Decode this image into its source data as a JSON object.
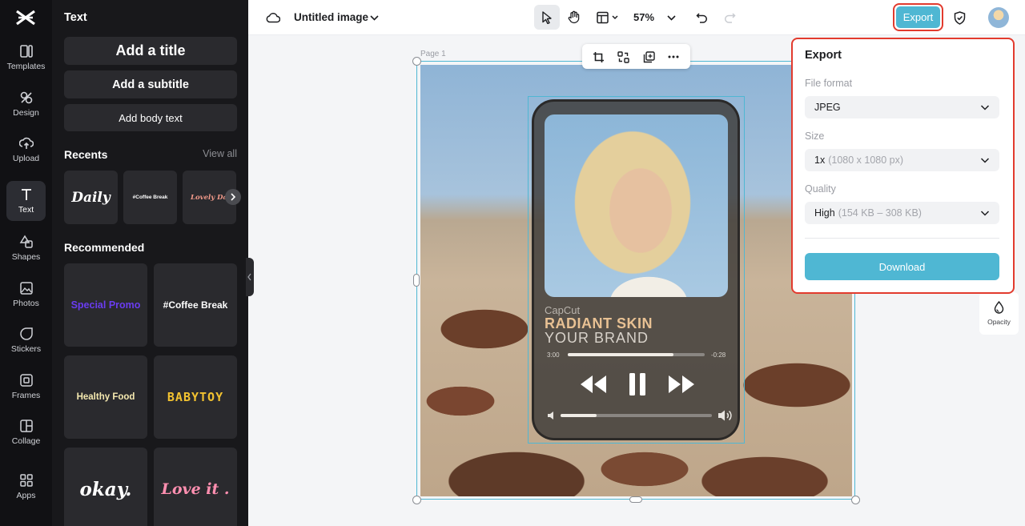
{
  "rail": {
    "items": [
      {
        "label": "Templates",
        "icon": "templates-icon"
      },
      {
        "label": "Design",
        "icon": "design-icon"
      },
      {
        "label": "Upload",
        "icon": "upload-icon"
      },
      {
        "label": "Text",
        "icon": "text-icon"
      },
      {
        "label": "Shapes",
        "icon": "shapes-icon"
      },
      {
        "label": "Photos",
        "icon": "photos-icon"
      },
      {
        "label": "Stickers",
        "icon": "stickers-icon"
      },
      {
        "label": "Frames",
        "icon": "frames-icon"
      },
      {
        "label": "Collage",
        "icon": "collage-icon"
      },
      {
        "label": "Apps",
        "icon": "apps-icon"
      }
    ],
    "active": "Text"
  },
  "panel": {
    "title": "Text",
    "add_title": "Add a title",
    "add_subtitle": "Add a subtitle",
    "add_body": "Add body text",
    "recents_title": "Recents",
    "view_all": "View all",
    "recents": [
      "Daily",
      "#Coffee Break",
      "Lovely Day"
    ],
    "recommended_title": "Recommended",
    "recommended": [
      "Special Promo",
      "#Coffee Break",
      "Healthy Food",
      "BABYTOY",
      "okay.",
      "Love it ."
    ]
  },
  "topbar": {
    "doc_title": "Untitled image",
    "zoom": "57%",
    "export_label": "Export"
  },
  "canvas": {
    "page_label": "Page 1",
    "player": {
      "app_name": "CapCut",
      "headline": "RADIANT SKIN",
      "subline": "YOUR BRAND",
      "time_elapsed": "3:00",
      "time_remaining": "-0:28",
      "progress": 0.77,
      "volume": 0.24
    }
  },
  "side": {
    "opacity_label": "Opacity"
  },
  "export_panel": {
    "title": "Export",
    "file_format_label": "File format",
    "file_format_value": "JPEG",
    "size_label": "Size",
    "size_value": "1x",
    "size_detail": "(1080 x 1080 px)",
    "quality_label": "Quality",
    "quality_value": "High",
    "quality_detail": "(154 KB – 308 KB)",
    "download_label": "Download"
  },
  "colors": {
    "accent": "#4fb7d3",
    "highlight": "#e23b2e",
    "headline": "#e8c193"
  }
}
